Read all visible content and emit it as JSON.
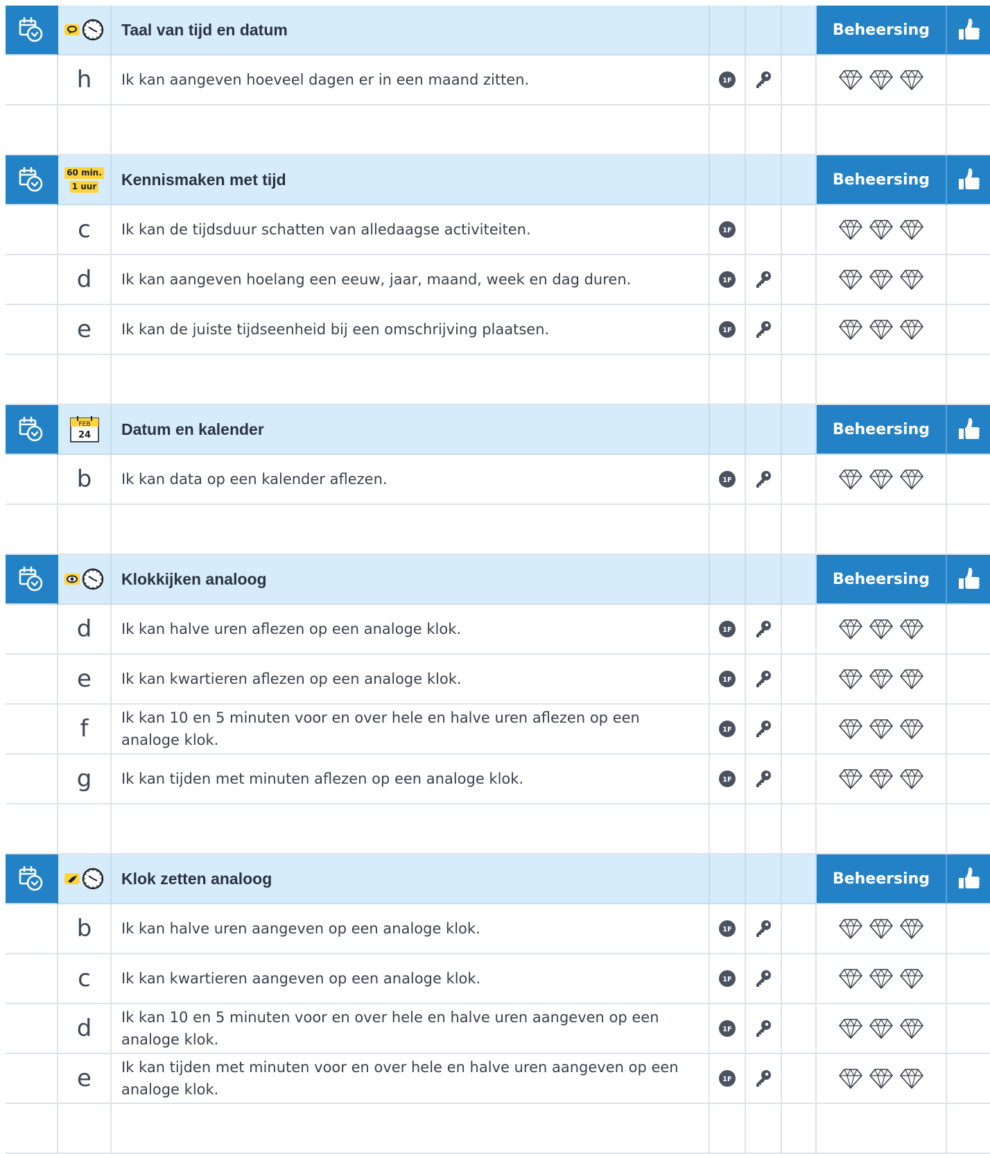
{
  "beheersing_label": "Beheersing",
  "sections": [
    {
      "title": "Taal van tijd en datum",
      "icon": "speech-clock-icon",
      "items": [
        {
          "letter": "h",
          "text": "Ik kan aangeven hoeveel dagen er in een maand zitten.",
          "f": true,
          "key": true
        }
      ]
    },
    {
      "title": "Kennismaken met tijd",
      "icon": "60-min-1-uur-icon",
      "icon_text": [
        "60 min.",
        "1 uur"
      ],
      "items": [
        {
          "letter": "c",
          "text": "Ik kan de tijdsduur schatten van alledaagse activiteiten.",
          "f": true,
          "key": false
        },
        {
          "letter": "d",
          "text": "Ik kan aangeven hoelang een eeuw, jaar, maand, week en dag duren.",
          "f": true,
          "key": true
        },
        {
          "letter": "e",
          "text": "Ik kan de juiste tijdseenheid bij een omschrijving plaatsen.",
          "f": true,
          "key": true
        }
      ]
    },
    {
      "title": "Datum en kalender",
      "icon": "calendar-feb-24-icon",
      "icon_text": [
        "FEB",
        "24"
      ],
      "items": [
        {
          "letter": "b",
          "text": "Ik kan data op een kalender aflezen.",
          "f": true,
          "key": true
        }
      ]
    },
    {
      "title": "Klokkijken analoog",
      "icon": "eye-clock-icon",
      "items": [
        {
          "letter": "d",
          "text": "Ik kan halve uren aflezen op een analoge klok.",
          "f": true,
          "key": true
        },
        {
          "letter": "e",
          "text": "Ik kan kwartieren aflezen op een analoge klok.",
          "f": true,
          "key": true
        },
        {
          "letter": "f",
          "text": "Ik kan 10 en 5 minuten voor en over hele en halve uren aflezen op een analoge klok.",
          "f": true,
          "key": true
        },
        {
          "letter": "g",
          "text": "Ik kan tijden met minuten aflezen op een analoge klok.",
          "f": true,
          "key": true
        }
      ]
    },
    {
      "title": "Klok zetten analoog",
      "icon": "hand-clock-icon",
      "items": [
        {
          "letter": "b",
          "text": "Ik kan halve uren aangeven op een analoge klok.",
          "f": true,
          "key": true
        },
        {
          "letter": "c",
          "text": "Ik kan kwartieren aangeven op een analoge klok.",
          "f": true,
          "key": true
        },
        {
          "letter": "d",
          "text": "Ik kan 10 en 5 minuten voor en over hele en halve uren aangeven op een analoge klok.",
          "f": true,
          "key": true
        },
        {
          "letter": "e",
          "text": "Ik kan tijden met minuten voor en over hele en halve uren aangeven op een analoge klok.",
          "f": true,
          "key": true
        }
      ]
    }
  ],
  "icons": {
    "level": "1F",
    "gem_count": 3
  },
  "colors": {
    "header_blue": "#2381c6",
    "header_light": "#d6ecfa",
    "tag_yellow": "#ffd43b"
  }
}
